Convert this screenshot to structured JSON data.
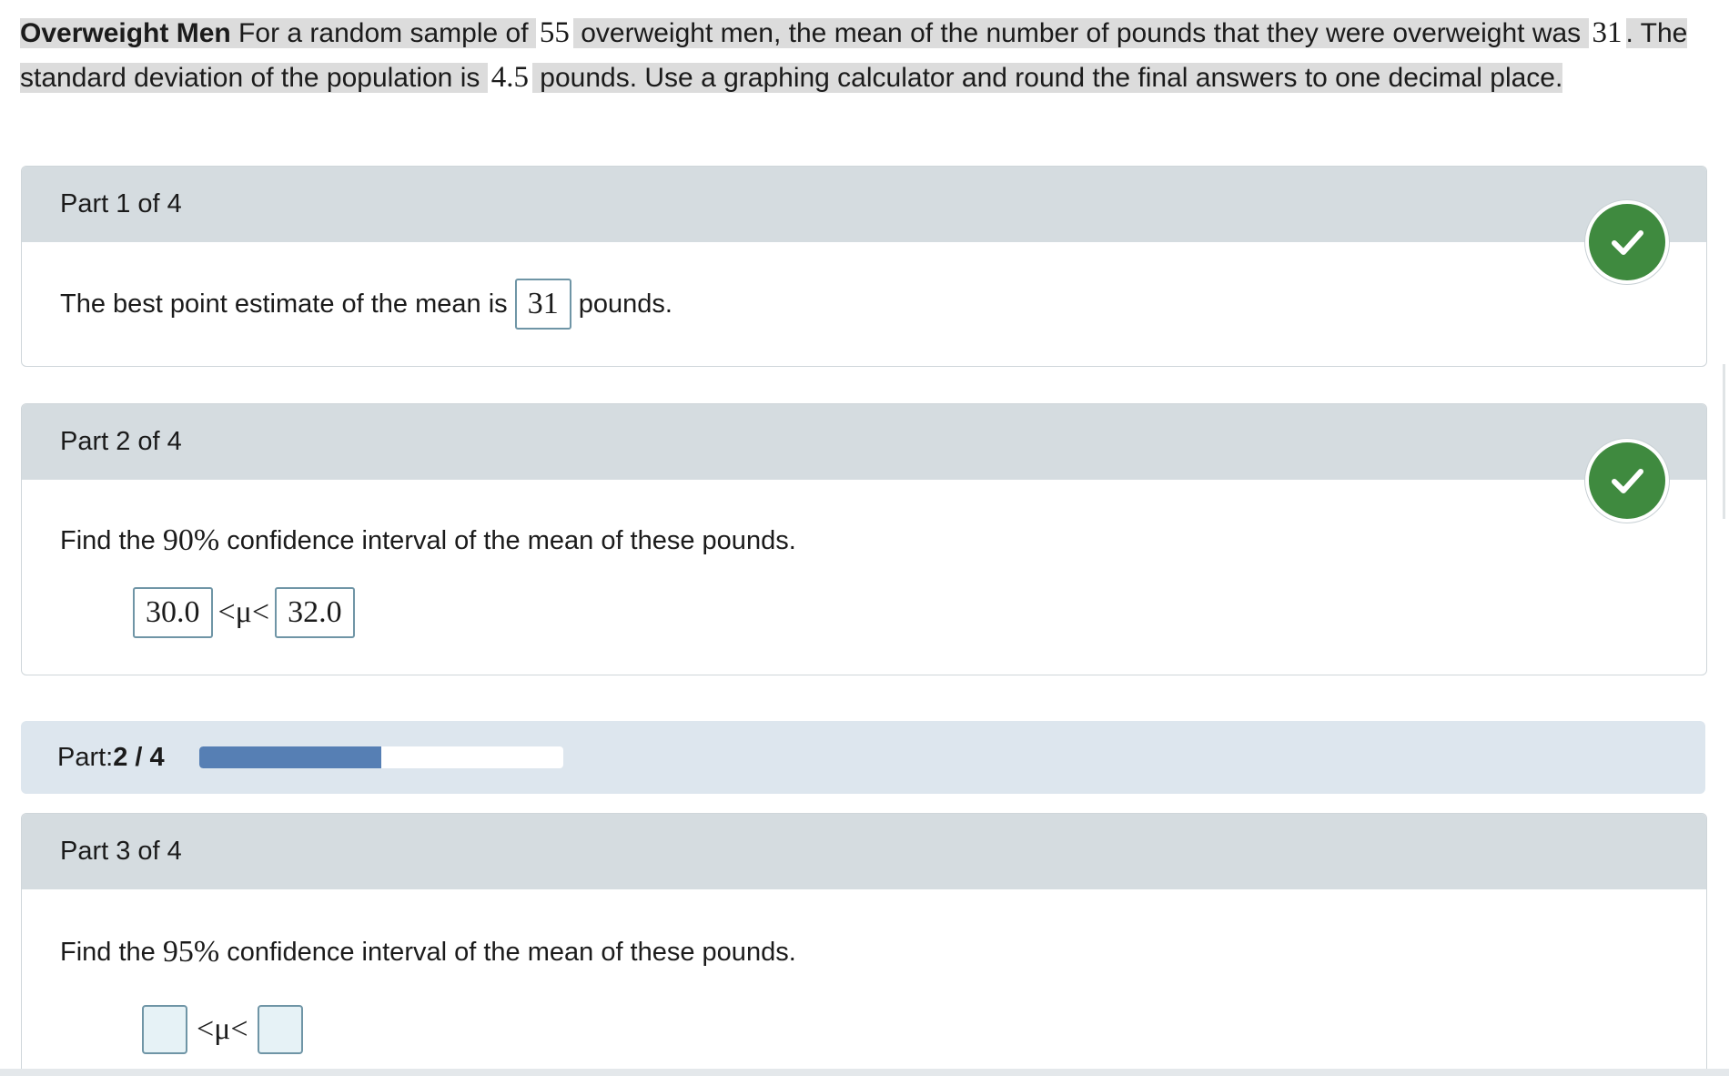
{
  "problem": {
    "title": "Overweight Men",
    "text_1": " For a random sample of ",
    "n": "55",
    "text_2": " overweight men, the mean of the number of pounds that they were overweight was ",
    "mean": "31",
    "text_3": ". The standard deviation of the population is ",
    "sigma": "4.5",
    "text_4": " pounds. Use a graphing calculator and round the final answers to one decimal place."
  },
  "part1": {
    "label": "Part 1 of 4",
    "prompt_before": "The best point estimate of the mean is ",
    "answer": "31",
    "prompt_after": " pounds.",
    "status_icon": "checkmark-icon"
  },
  "part2": {
    "label": "Part 2 of 4",
    "prompt_before": "Find the ",
    "percent": "90%",
    "prompt_after": " confidence interval of the mean of these pounds.",
    "lower": "30.0",
    "symbol": "<μ<",
    "upper": "32.0",
    "status_icon": "checkmark-icon"
  },
  "progress": {
    "label": "Part: ",
    "value_text": "2 / 4",
    "fraction": 0.5,
    "color": "#567fb4"
  },
  "part3": {
    "label": "Part 3 of 4",
    "prompt_before": "Find the ",
    "percent": "95%",
    "prompt_after": " confidence interval of the mean of these pounds.",
    "symbol": "<μ<",
    "lower": "",
    "upper": ""
  },
  "colors": {
    "check_green": "#3f8a3f",
    "panel_header": "#d5dce0",
    "progress_strip": "#dde6ee",
    "box_border": "#6f95a6"
  }
}
